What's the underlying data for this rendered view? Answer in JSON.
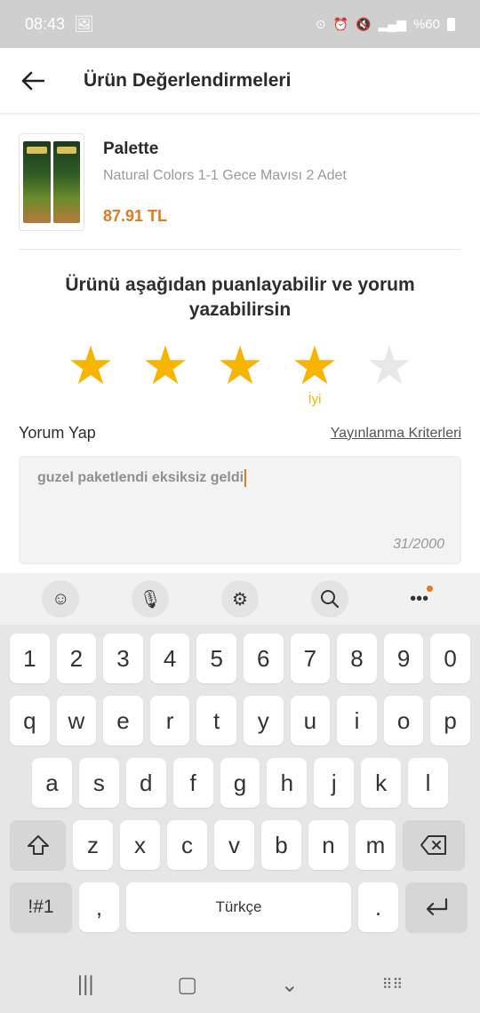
{
  "status": {
    "time": "08:43",
    "battery_text": "%60"
  },
  "app_bar": {
    "title": "Ürün Değerlendirmeleri"
  },
  "product": {
    "brand": "Palette",
    "name": "Natural Colors 1-1 Gece Mavısı 2 Adet",
    "price": "87.91 TL"
  },
  "rating": {
    "prompt": "Ürünü aşağıdan puanlayabilir ve yorum yazabilirsin",
    "value": 4,
    "max": 5,
    "label": "İyi",
    "star_active_color": "#f7b500",
    "star_inactive_color": "#e8e8e8"
  },
  "comment": {
    "title": "Yorum Yap",
    "criteria_link": "Yayınlanma Kriterleri",
    "text": "guzel paketlendi eksiksiz geldi",
    "counter": "31/2000"
  },
  "keyboard": {
    "toolbar": [
      "emoji-icon",
      "mic-icon",
      "settings-icon",
      "search-icon",
      "more-icon"
    ],
    "row_numbers": [
      "1",
      "2",
      "3",
      "4",
      "5",
      "6",
      "7",
      "8",
      "9",
      "0"
    ],
    "row_top": [
      "q",
      "w",
      "e",
      "r",
      "t",
      "y",
      "u",
      "i",
      "o",
      "p"
    ],
    "row_mid": [
      "a",
      "s",
      "d",
      "f",
      "g",
      "h",
      "j",
      "k",
      "l"
    ],
    "row_bottom": [
      "z",
      "x",
      "c",
      "v",
      "b",
      "n",
      "m"
    ],
    "symbols_key": "!#1",
    "comma_key": ",",
    "space_label": "Türkçe",
    "period_key": "."
  },
  "colors": {
    "accent": "#e07b1f",
    "status_bar": "#cfcfcf"
  }
}
